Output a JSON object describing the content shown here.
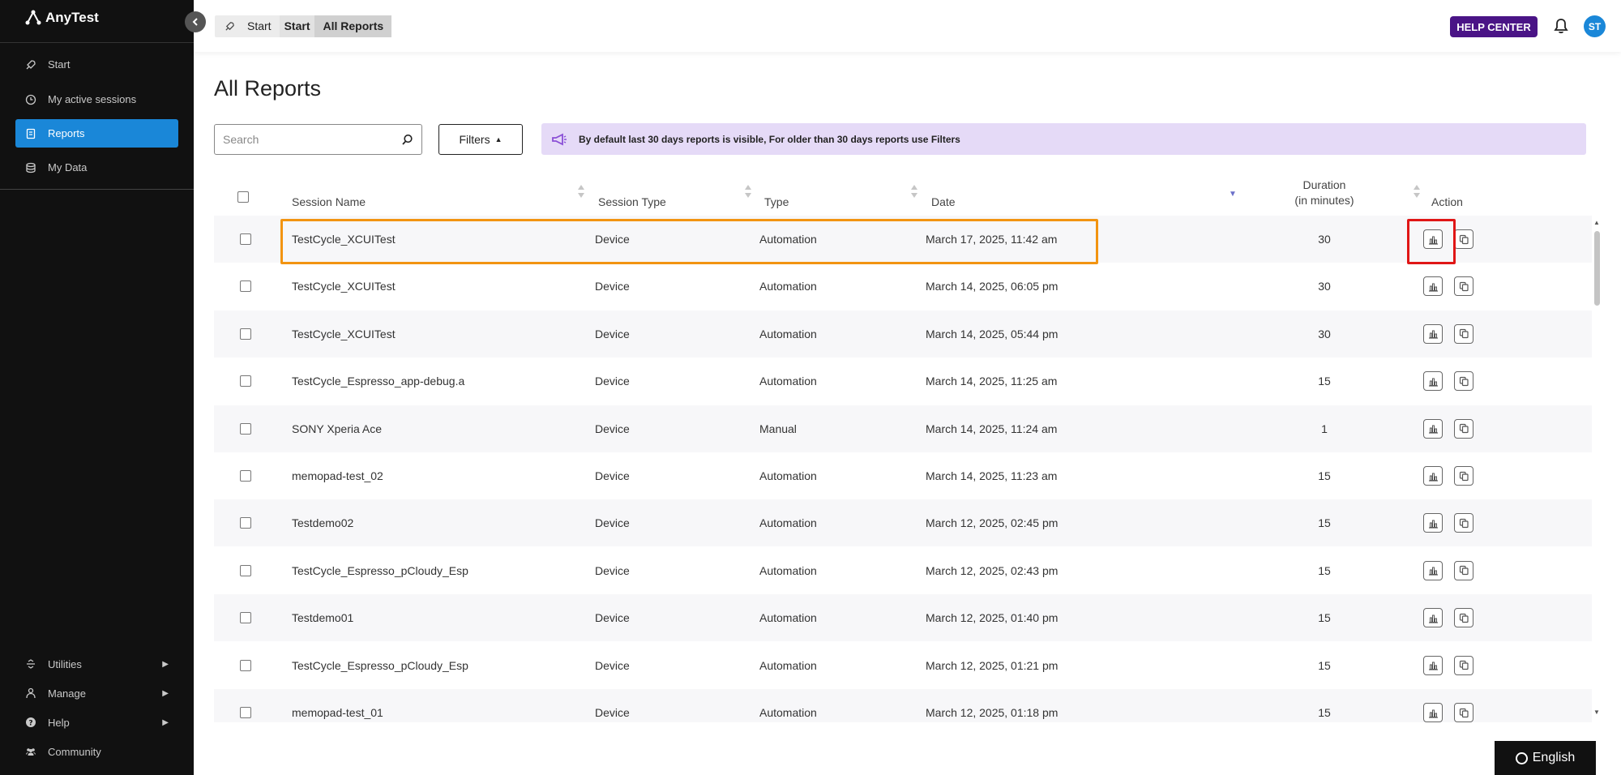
{
  "brand": {
    "name": "AnyTest"
  },
  "sidebar": {
    "items": [
      {
        "label": "Start",
        "icon": "rocket-icon"
      },
      {
        "label": "My active sessions",
        "icon": "clock-icon"
      },
      {
        "label": "Reports",
        "icon": "report-icon",
        "active": true
      },
      {
        "label": "My Data",
        "icon": "database-icon"
      }
    ],
    "bottom_items": [
      {
        "label": "Utilities",
        "icon": "utilities-icon",
        "arrow": "▶"
      },
      {
        "label": "Manage",
        "icon": "person-icon",
        "arrow": "▶"
      },
      {
        "label": "Help",
        "icon": "question-icon",
        "arrow": "▶"
      },
      {
        "label": "Community",
        "icon": "community-icon"
      }
    ]
  },
  "topbar": {
    "breadcrumb": [
      "Start",
      "Start",
      "All Reports"
    ],
    "help_label": "HELP CENTER",
    "avatar_initials": "ST",
    "accent_color": "#4a1486"
  },
  "main": {
    "title": "All Reports",
    "search_placeholder": "Search",
    "filters_label": "Filters",
    "notice_text": "By default last 30 days reports is visible, For older than 30 days reports use Filters"
  },
  "table": {
    "columns": {
      "session_name": "Session Name",
      "session_type": "Session Type",
      "type": "Type",
      "date": "Date",
      "duration_line1": "Duration",
      "duration_line2": "(in minutes)",
      "action": "Action"
    },
    "rows": [
      {
        "name": "TestCycle_XCUITest",
        "session_type": "Device",
        "type": "Automation",
        "date": "March 17, 2025, 11:42 am",
        "duration": "30"
      },
      {
        "name": "TestCycle_XCUITest",
        "session_type": "Device",
        "type": "Automation",
        "date": "March 14, 2025, 06:05 pm",
        "duration": "30"
      },
      {
        "name": "TestCycle_XCUITest",
        "session_type": "Device",
        "type": "Automation",
        "date": "March 14, 2025, 05:44 pm",
        "duration": "30"
      },
      {
        "name": "TestCycle_Espresso_app-debug.a",
        "session_type": "Device",
        "type": "Automation",
        "date": "March 14, 2025, 11:25 am",
        "duration": "15"
      },
      {
        "name": "SONY Xperia Ace",
        "session_type": "Device",
        "type": "Manual",
        "date": "March 14, 2025, 11:24 am",
        "duration": "1"
      },
      {
        "name": "memopad-test_02",
        "session_type": "Device",
        "type": "Automation",
        "date": "March 14, 2025, 11:23 am",
        "duration": "15"
      },
      {
        "name": "Testdemo02",
        "session_type": "Device",
        "type": "Automation",
        "date": "March 12, 2025, 02:45 pm",
        "duration": "15"
      },
      {
        "name": "TestCycle_Espresso_pCloudy_Esp",
        "session_type": "Device",
        "type": "Automation",
        "date": "March 12, 2025, 02:43 pm",
        "duration": "15"
      },
      {
        "name": "Testdemo01",
        "session_type": "Device",
        "type": "Automation",
        "date": "March 12, 2025, 01:40 pm",
        "duration": "15"
      },
      {
        "name": "TestCycle_Espresso_pCloudy_Esp",
        "session_type": "Device",
        "type": "Automation",
        "date": "March 12, 2025, 01:21 pm",
        "duration": "15"
      },
      {
        "name": "memopad-test_01",
        "session_type": "Device",
        "type": "Automation",
        "date": "March 12, 2025, 01:18 pm",
        "duration": "15"
      }
    ]
  },
  "footer": {
    "language": "English"
  },
  "colors": {
    "active_nav": "#1a87d8",
    "highlight_orange": "#f29411",
    "highlight_red": "#e01616",
    "notice_bg": "#e5daf7"
  }
}
